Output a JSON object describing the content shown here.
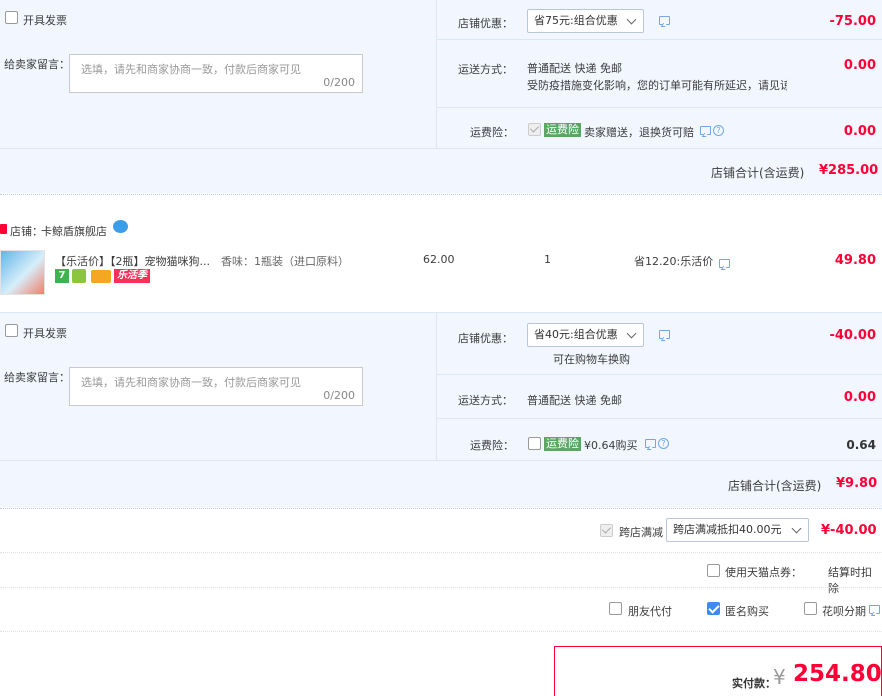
{
  "store1": {
    "invoice_label": "开具发票",
    "discount_label": "店铺优惠：",
    "discount_select": "省75元:组合优惠",
    "discount_value": "-75.00",
    "message_label": "给卖家留言：",
    "message_placeholder": "选填，请先和商家协商一致，付款后商家可见",
    "message_count": "0/200",
    "shipping_label": "运送方式：",
    "shipping_method": "普通配送 快递 免邮",
    "shipping_note": "受防疫措施变化影响，您的订单可能有所延迟，请见谅",
    "shipping_value": "0.00",
    "insurance_label": "运费险：",
    "insurance_tag": "运费险",
    "insurance_text": "卖家赠送，退换货可赔",
    "insurance_value": "0.00",
    "total_label": "店铺合计(含运费)",
    "total_value": "¥285.00"
  },
  "store2": {
    "store_label": "店铺：",
    "store_name": "卡鲸盾旗舰店",
    "product": {
      "title": "【乐活价】【2瓶】宠物猫咪狗...",
      "variant": "香味：1瓶装（进口原料）",
      "price": "62.00",
      "quantity": "1",
      "promo": "省12.20:乐活价",
      "subtotal": "49.80",
      "badge_seven": "7",
      "badge_lehuo": "乐活季"
    },
    "invoice_label": "开具发票",
    "discount_label": "店铺优惠：",
    "discount_select": "省40元:组合优惠",
    "discount_note": "可在购物车换购",
    "discount_value": "-40.00",
    "message_label": "给卖家留言：",
    "message_placeholder": "选填，请先和商家协商一致，付款后商家可见",
    "message_count": "0/200",
    "shipping_label": "运送方式：",
    "shipping_method": "普通配送 快递 免邮",
    "shipping_value": "0.00",
    "insurance_label": "运费险：",
    "insurance_tag": "运费险",
    "insurance_text": "¥0.64购买",
    "insurance_value": "0.64",
    "total_label": "店铺合计(含运费)",
    "total_value": "¥9.80"
  },
  "order": {
    "cross_label": "跨店满减",
    "cross_select": "跨店满减抵扣40.00元",
    "cross_value": "¥-40.00",
    "coupon_label": "使用天猫点券：",
    "coupon_note": "结算时扣除",
    "friend_pay": "朋友代付",
    "anonymous": "匿名购买",
    "huabei": "花呗分期",
    "pay_label": "实付款：",
    "currency": "¥",
    "pay_value": "254.80"
  },
  "colors": {
    "accent_red": "#ff0036",
    "panel_blue": "#f2f7ff",
    "insurance_green": "#5ca664"
  }
}
